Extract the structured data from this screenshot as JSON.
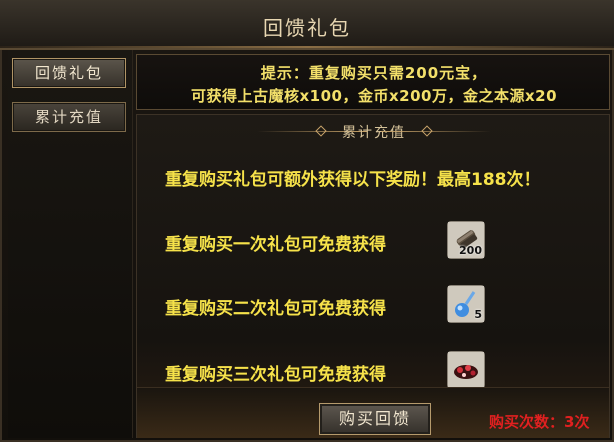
{
  "window": {
    "title": "回馈礼包"
  },
  "sidebar": {
    "tabs": [
      {
        "label": "回馈礼包",
        "active": true
      },
      {
        "label": "累计充值",
        "active": false
      }
    ]
  },
  "hint": {
    "line1": "提示：重复购买只需200元宝，",
    "line2": "可获得上古魔核x100，金币x200万，金之本源x20"
  },
  "panel": {
    "header": "累计充值",
    "intro": "重复购买礼包可额外获得以下奖励！最高188次！",
    "rewards": [
      {
        "text": "重复购买一次礼包可免费获得",
        "icon": "scroll-icon",
        "count": "200"
      },
      {
        "text": "重复购买二次礼包可免费获得",
        "icon": "blue-potion-icon",
        "count": "5"
      },
      {
        "text": "重复购买三次礼包可免费获得",
        "icon": "red-gem-icon",
        "count": ""
      }
    ],
    "buy_button": "购买回馈",
    "buy_count": "购买次数：3次"
  },
  "colors": {
    "accent_gold": "#f6e24a",
    "count_red": "#e02020",
    "frame": "#5a4a33"
  }
}
